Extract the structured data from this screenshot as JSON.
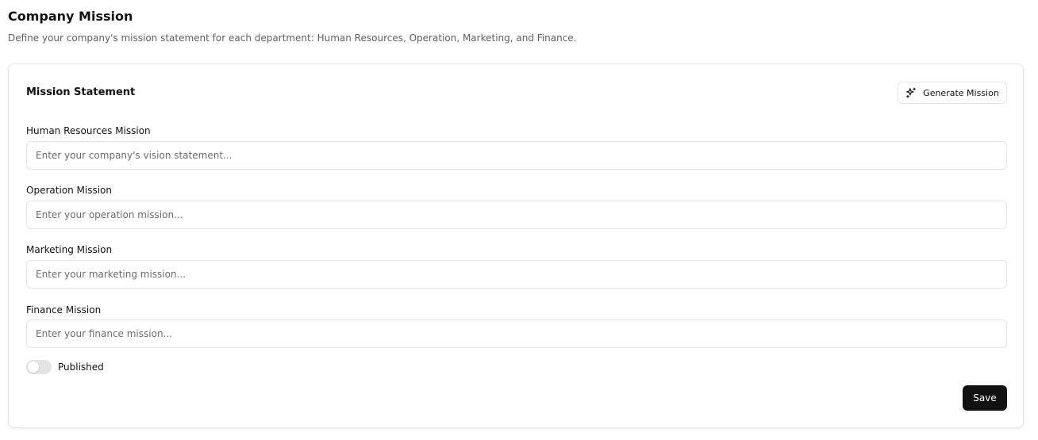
{
  "header": {
    "title": "Company Mission",
    "subtitle": "Define your company's mission statement for each department: Human Resources, Operation, Marketing, and Finance."
  },
  "card": {
    "title": "Mission Statement",
    "generate_button": {
      "label": "Generate Mission",
      "icon": "sparkles-icon"
    },
    "fields": [
      {
        "label": "Human Resources Mission",
        "value": "",
        "placeholder": "Enter your company's vision statement..."
      },
      {
        "label": "Operation Mission",
        "value": "",
        "placeholder": "Enter your operation mission..."
      },
      {
        "label": "Marketing Mission",
        "value": "",
        "placeholder": "Enter your marketing mission..."
      },
      {
        "label": "Finance Mission",
        "value": "",
        "placeholder": "Enter your finance mission..."
      }
    ],
    "published_toggle": {
      "label": "Published",
      "on": false
    },
    "save_label": "Save"
  },
  "colors": {
    "primary": "#111111",
    "border": "#e4e4e7",
    "muted_text": "#5f5f5f",
    "toggle_off": "#e4e4e7"
  }
}
